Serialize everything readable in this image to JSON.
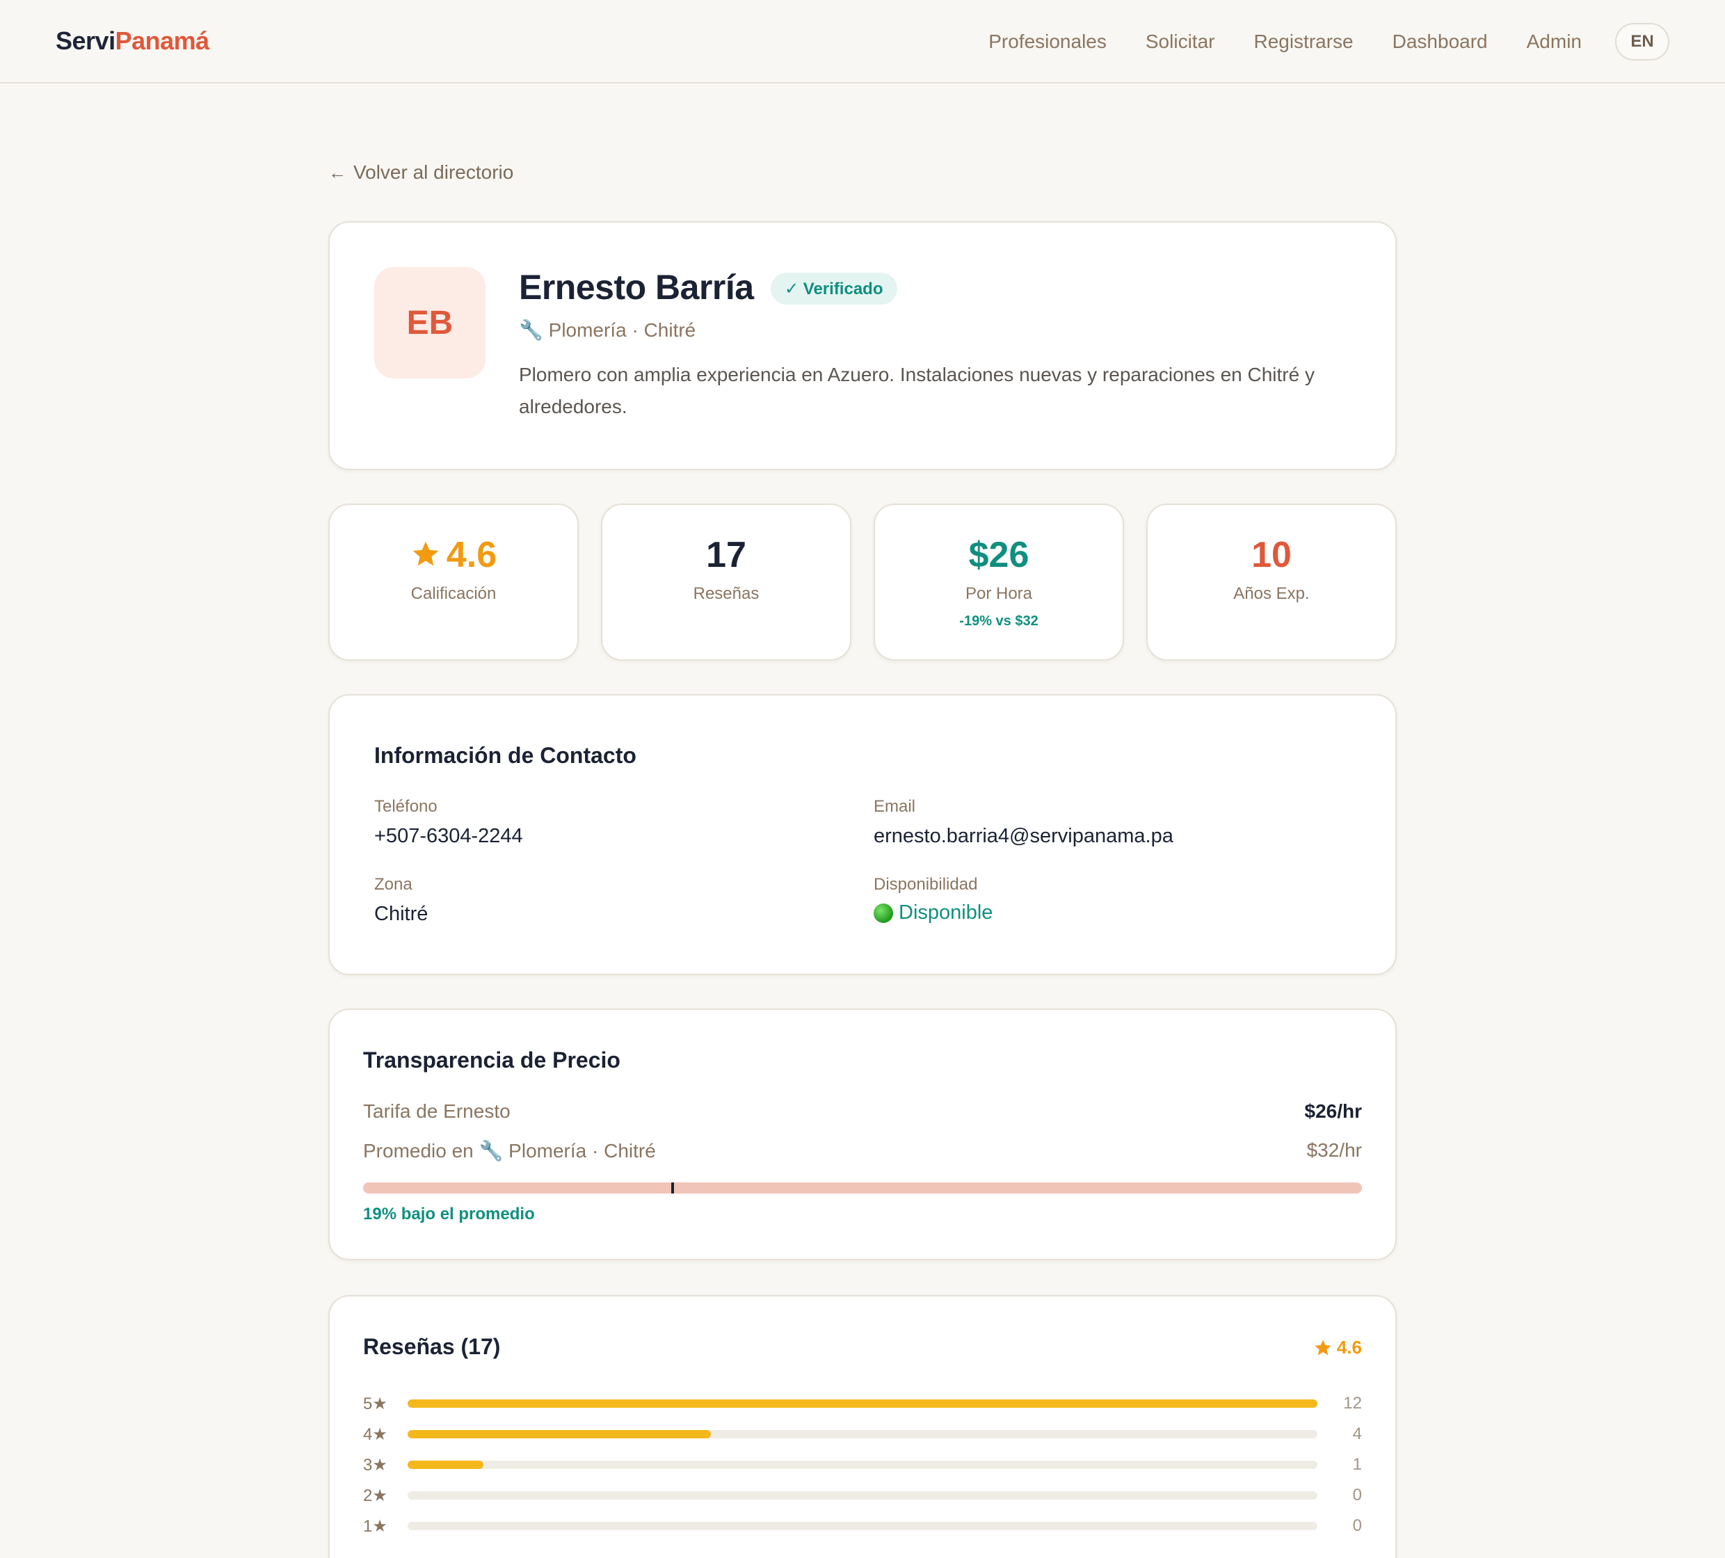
{
  "brand": {
    "part1": "Servi",
    "part2": "Panamá"
  },
  "nav": {
    "items": [
      "Profesionales",
      "Solicitar",
      "Registrarse",
      "Dashboard",
      "Admin"
    ],
    "lang": "EN"
  },
  "back": {
    "label": "Volver al directorio"
  },
  "profile": {
    "initials": "EB",
    "name": "Ernesto Barría",
    "verified": "✓ Verificado",
    "meta": "🔧 Plomería · Chitré",
    "description": "Plomero con amplia experiencia en Azuero. Instalaciones nuevas y reparaciones en Chitré y alrededores."
  },
  "stats": {
    "rating": {
      "value": "4.6",
      "label": "Calificación"
    },
    "reviews": {
      "value": "17",
      "label": "Reseñas"
    },
    "rate": {
      "value": "$26",
      "label": "Por Hora",
      "sub": "-19% vs $32"
    },
    "experience": {
      "value": "10",
      "label": "Años Exp."
    }
  },
  "contact": {
    "title": "Información de Contacto",
    "phone_label": "Teléfono",
    "phone": "+507-6304-2244",
    "email_label": "Email",
    "email": "ernesto.barria4@servipanama.pa",
    "zone_label": "Zona",
    "zone": "Chitré",
    "availability_label": "Disponibilidad",
    "availability": "Disponible"
  },
  "pricing": {
    "title": "Transparencia de Precio",
    "own_label": "Tarifa de Ernesto",
    "own_value": "$26/hr",
    "avg_label": "Promedio en 🔧 Plomería · Chitré",
    "avg_value": "$32/hr",
    "marker_fraction": 0.31,
    "note": "19% bajo el promedio"
  },
  "reviews": {
    "title": "Reseñas (17)",
    "average": "4.6",
    "distribution": [
      {
        "label": "5★",
        "count": 12,
        "fraction": 1.0
      },
      {
        "label": "4★",
        "count": 4,
        "fraction": 0.333
      },
      {
        "label": "3★",
        "count": 1,
        "fraction": 0.083
      },
      {
        "label": "2★",
        "count": 0,
        "fraction": 0
      },
      {
        "label": "1★",
        "count": 0,
        "fraction": 0
      }
    ]
  },
  "colors": {
    "brand_accent": "#e0583a",
    "teal": "#0f8f7f",
    "star": "#f29a12",
    "bar_fill": "#f4b81c"
  }
}
